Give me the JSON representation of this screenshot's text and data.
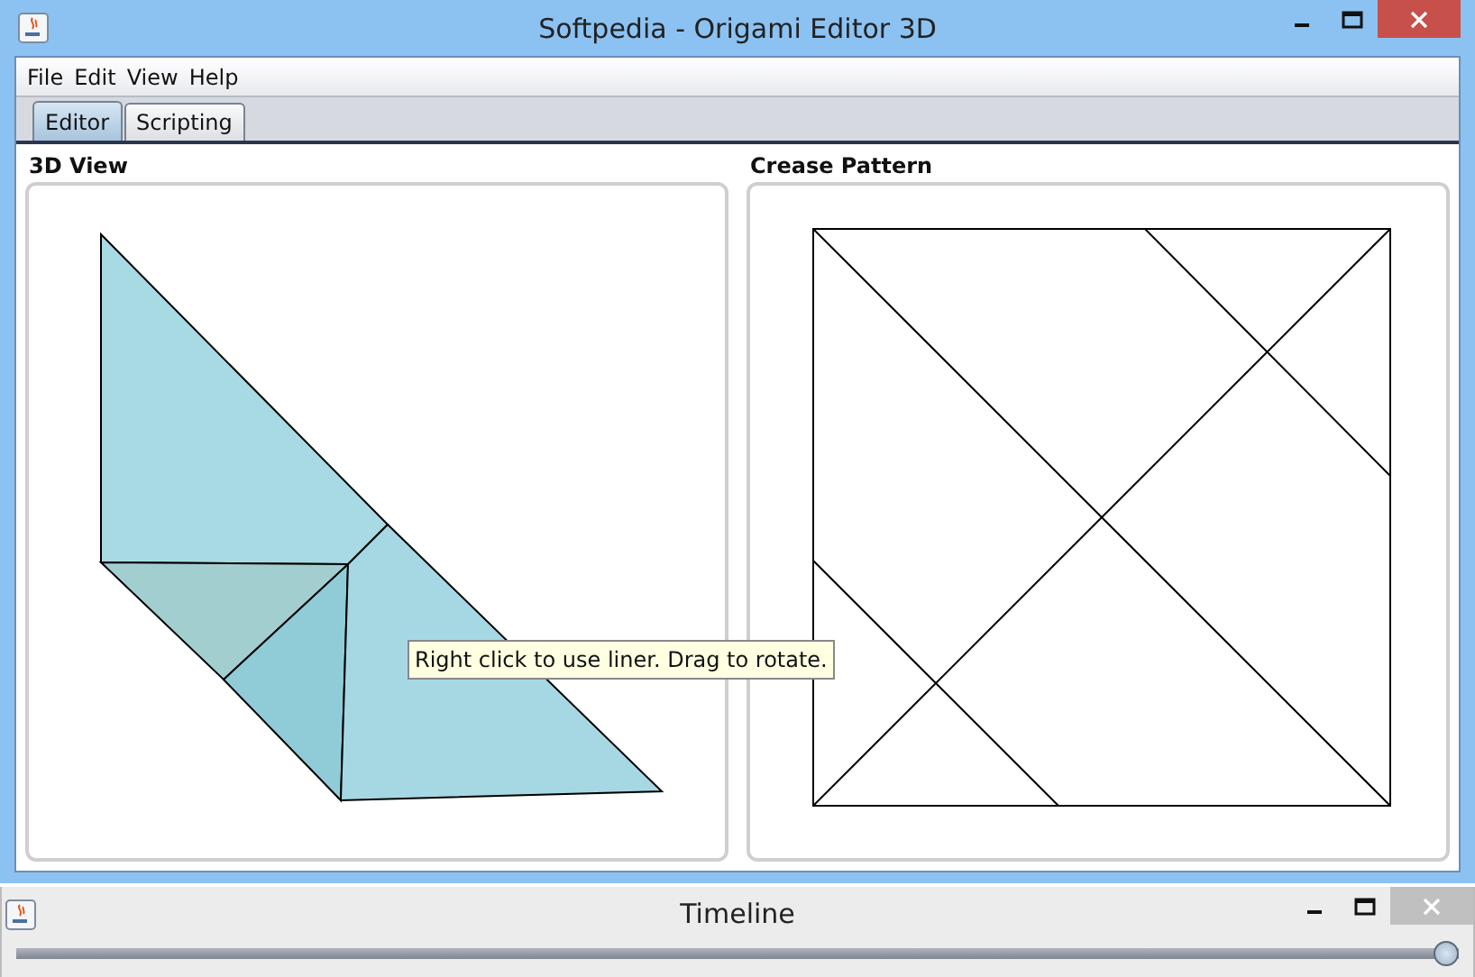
{
  "window": {
    "title": "Softpedia - Origami Editor 3D"
  },
  "menu": [
    "File",
    "Edit",
    "View",
    "Help"
  ],
  "tabs": [
    {
      "label": "Editor",
      "selected": true
    },
    {
      "label": "Scripting",
      "selected": false
    }
  ],
  "panels": [
    {
      "title": "3D View",
      "kind": "view3d"
    },
    {
      "title": "Crease Pattern",
      "kind": "crease"
    }
  ],
  "tooltip": "Right click to use liner. Drag to rotate.",
  "timeline": {
    "title": "Timeline",
    "level": 1
  }
}
